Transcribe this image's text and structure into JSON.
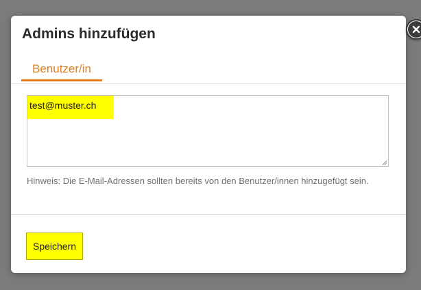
{
  "dialog": {
    "title": "Admins hinzufügen",
    "close_icon": "close-icon",
    "tabs": [
      {
        "label": "Benutzer/in",
        "active": true
      }
    ],
    "textarea": {
      "value": "test@muster.ch"
    },
    "hint": "Hinweis: Die E-Mail-Adressen sollten bereits von den Benutzer/innen hinzugefügt sein.",
    "save_label": "Speichern"
  },
  "colors": {
    "accent": "#e07f1b",
    "highlight": "#ffff00",
    "overlay": "#7b7b7b"
  }
}
